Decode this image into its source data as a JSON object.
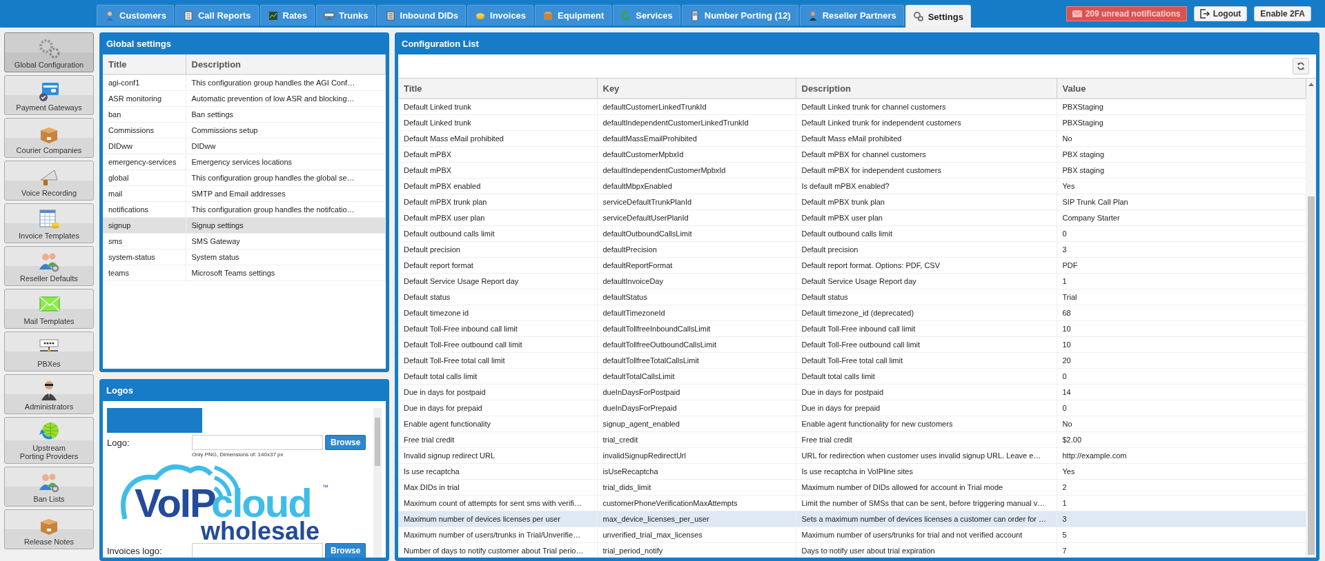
{
  "top_bar": {
    "tabs": [
      {
        "label": "Customers",
        "selected": false
      },
      {
        "label": "Call Reports",
        "selected": false
      },
      {
        "label": "Rates",
        "selected": false
      },
      {
        "label": "Trunks",
        "selected": false
      },
      {
        "label": "Inbound DIDs",
        "selected": false
      },
      {
        "label": "Invoices",
        "selected": false
      },
      {
        "label": "Equipment",
        "selected": false
      },
      {
        "label": "Services",
        "selected": false
      },
      {
        "label": "Number Porting (12)",
        "selected": false
      },
      {
        "label": "Reseller Partners",
        "selected": false
      },
      {
        "label": "Settings",
        "selected": true
      }
    ],
    "notifications": "209 unread notifications",
    "logout": "Logout",
    "enable_2fa": "Enable 2FA"
  },
  "sidebar": {
    "items": [
      {
        "label": "Global Configuration",
        "selected": true
      },
      {
        "label": "Payment Gateways",
        "selected": false
      },
      {
        "label": "Courier Companies",
        "selected": false
      },
      {
        "label": "Voice Recording",
        "selected": false
      },
      {
        "label": "Invoice Templates",
        "selected": false
      },
      {
        "label": "Reseller Defaults",
        "selected": false
      },
      {
        "label": "Mail Templates",
        "selected": false
      },
      {
        "label": "PBXes",
        "selected": false
      },
      {
        "label": "Administrators",
        "selected": false
      },
      {
        "label": "Upstream\nPorting Providers",
        "selected": false
      },
      {
        "label": "Ban Lists",
        "selected": false
      },
      {
        "label": "Release Notes",
        "selected": false
      }
    ]
  },
  "global_settings": {
    "title": "Global settings",
    "columns": [
      "Title",
      "Description"
    ],
    "rows": [
      {
        "title": "agi-conf1",
        "description": "This configuration group handles the AGI Conf…",
        "selected": false
      },
      {
        "title": "ASR monitoring",
        "description": "Automatic prevention of low ASR and blocking…",
        "selected": false
      },
      {
        "title": "ban",
        "description": "Ban settings",
        "selected": false
      },
      {
        "title": "Commissions",
        "description": "Commissions setup",
        "selected": false
      },
      {
        "title": "DIDww",
        "description": "DIDww",
        "selected": false
      },
      {
        "title": "emergency-services",
        "description": "Emergency services locations",
        "selected": false
      },
      {
        "title": "global",
        "description": "This configuration group handles the global se…",
        "selected": false
      },
      {
        "title": "mail",
        "description": "SMTP and Email addresses",
        "selected": false
      },
      {
        "title": "notifications",
        "description": "This configuration group handles the notifcatio…",
        "selected": false
      },
      {
        "title": "signup",
        "description": "Signup settings",
        "selected": true
      },
      {
        "title": "sms",
        "description": "SMS Gateway",
        "selected": false
      },
      {
        "title": "system-status",
        "description": "System status",
        "selected": false
      },
      {
        "title": "teams",
        "description": "Microsoft Teams settings",
        "selected": false
      }
    ]
  },
  "logos": {
    "title": "Logos",
    "fields": [
      {
        "label": "Logo:",
        "button": "Browse",
        "hint": "Only PNG, Dimensions of: 140x37 px"
      },
      {
        "label": "Invoices logo:",
        "button": "Browse"
      }
    ],
    "brand": {
      "part_1": "VoIP",
      "part_2": "cloud",
      "mark": "™",
      "tagline": "wholesale"
    }
  },
  "configuration_list": {
    "title": "Configuration List",
    "columns": [
      "Title",
      "Key",
      "Description",
      "Value"
    ],
    "rows": [
      {
        "title": "Default Linked trunk",
        "key": "defaultCustomerLinkedTrunkId",
        "description": "Default Linked trunk for channel customers",
        "value": "PBXStaging",
        "selected": false
      },
      {
        "title": "Default Linked trunk",
        "key": "defaultIndependentCustomerLinkedTrunkId",
        "description": "Default Linked trunk for independent customers",
        "value": "PBXStaging",
        "selected": false
      },
      {
        "title": "Default Mass eMail prohibited",
        "key": "defaultMassEmailProhibited",
        "description": "Default Mass eMail prohibited",
        "value": "No",
        "selected": false
      },
      {
        "title": "Default mPBX",
        "key": "defaultCustomerMpbxId",
        "description": "Default mPBX for channel customers",
        "value": "PBX staging",
        "selected": false
      },
      {
        "title": "Default mPBX",
        "key": "defaultIndependentCustomerMpbxId",
        "description": "Default mPBX for independent customers",
        "value": "PBX staging",
        "selected": false
      },
      {
        "title": "Default mPBX enabled",
        "key": "defaultMbpxEnabled",
        "description": "Is default mPBX enabled?",
        "value": "Yes",
        "selected": false
      },
      {
        "title": "Default mPBX trunk plan",
        "key": "serviceDefaultTrunkPlanId",
        "description": "Default mPBX trunk plan",
        "value": "SIP Trunk Call Plan",
        "selected": false
      },
      {
        "title": "Default mPBX user plan",
        "key": "serviceDefaultUserPlanId",
        "description": "Default mPBX user plan",
        "value": "Company Starter",
        "selected": false
      },
      {
        "title": "Default outbound calls limit",
        "key": "defaultOutboundCallsLimit",
        "description": "Default outbound calls limit",
        "value": "0",
        "selected": false
      },
      {
        "title": "Default precision",
        "key": "defaultPrecision",
        "description": "Default precision",
        "value": "3",
        "selected": false
      },
      {
        "title": "Default report format",
        "key": "defaultReportFormat",
        "description": "Default report format. Options: PDF, CSV",
        "value": "PDF",
        "selected": false
      },
      {
        "title": "Default Service Usage Report day",
        "key": "defaultInvoiceDay",
        "description": "Default Service Usage Report day",
        "value": "1",
        "selected": false
      },
      {
        "title": "Default status",
        "key": "defaultStatus",
        "description": "Default status",
        "value": "Trial",
        "selected": false
      },
      {
        "title": "Default timezone id",
        "key": "defaultTimezoneId",
        "description": "Default timezone_id (deprecated)",
        "value": "68",
        "selected": false
      },
      {
        "title": "Default Toll-Free inbound call limit",
        "key": "defaultTollfreeInboundCallsLimit",
        "description": "Default Toll-Free inbound call limit",
        "value": "10",
        "selected": false
      },
      {
        "title": "Default Toll-Free outbound call limit",
        "key": "defaultTollfreeOutboundCallsLimit",
        "description": "Default Toll-Free outbound call limit",
        "value": "10",
        "selected": false
      },
      {
        "title": "Default Toll-Free total call limit",
        "key": "defaultTollfreeTotalCallsLimit",
        "description": "Default Toll-Free total call limit",
        "value": "20",
        "selected": false
      },
      {
        "title": "Default total calls limit",
        "key": "defaultTotalCallsLimit",
        "description": "Default total calls limit",
        "value": "0",
        "selected": false
      },
      {
        "title": "Due in days for postpaid",
        "key": "dueInDaysForPostpaid",
        "description": "Due in days for postpaid",
        "value": "14",
        "selected": false
      },
      {
        "title": "Due in days for prepaid",
        "key": "dueInDaysForPrepaid",
        "description": "Due in days for prepaid",
        "value": "0",
        "selected": false
      },
      {
        "title": "Enable agent functionality",
        "key": "signup_agent_enabled",
        "description": "Enable agent functionality for new customers",
        "value": "No",
        "selected": false
      },
      {
        "title": "Free trial credit",
        "key": "trial_credit",
        "description": "Free trial credit",
        "value": "$2.00",
        "selected": false
      },
      {
        "title": "Invalid signup redirect URL",
        "key": "invalidSignupRedirectUrl",
        "description": "URL for redirection when customer uses invalid signup URL. Leave e…",
        "value": "http://example.com",
        "selected": false
      },
      {
        "title": "Is use recaptcha",
        "key": "isUseRecaptcha",
        "description": "Is use recaptcha in VoIPline sites",
        "value": "Yes",
        "selected": false
      },
      {
        "title": "Max DIDs in trial",
        "key": "trial_dids_limit",
        "description": "Maximum number of DIDs allowed for account in Trial mode",
        "value": "2",
        "selected": false
      },
      {
        "title": "Maximum count of attempts for sent sms with verifi…",
        "key": "customerPhoneVerificationMaxAttempts",
        "description": "Limit the number of SMSs that can be sent, before triggering manual v…",
        "value": "1",
        "selected": false
      },
      {
        "title": "Maximum number of devices licenses per user",
        "key": "max_device_licenses_per_user",
        "description": "Sets a maximum number of devices licenses a customer can order for …",
        "value": "3",
        "selected": true
      },
      {
        "title": "Maximum number of users/trunks in Trial/Unverifie…",
        "key": "unverified_trial_max_licenses",
        "description": "Maximum number of users/trunks for trial and not verified account",
        "value": "5",
        "selected": false
      },
      {
        "title": "Number of days to notify customer about Trial perio…",
        "key": "trial_period_notify",
        "description": "Days to notify user about trial expiration",
        "value": "7",
        "selected": false
      }
    ]
  }
}
